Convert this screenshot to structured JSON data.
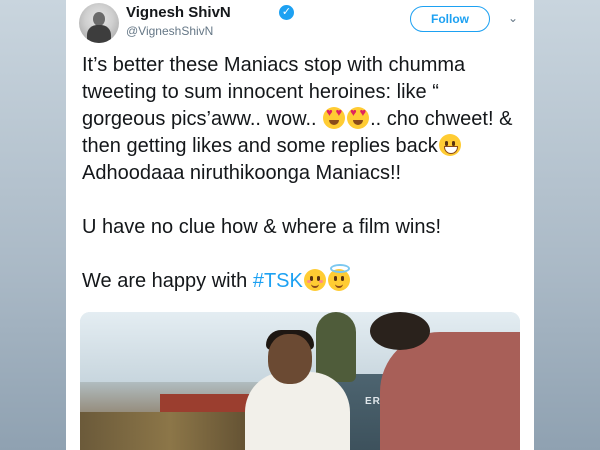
{
  "profile": {
    "name": "Vignesh ShivN",
    "handle": "@VigneshShivN",
    "verified_icon": "verified-badge-icon"
  },
  "header": {
    "follow_label": "Follow",
    "menu_icon": "chevron-down-icon"
  },
  "tweet": {
    "line1": "It’s better these Maniacs stop with chumma tweeting to sum innocent heroines: like “ gorgeous pics’aww.. wow..",
    "line1_after_emoji": ".. cho chweet! & then getting likes and some replies back",
    "line2": "Adhoodaaa niruthikoonga Maniacs!!",
    "line3": "U have no clue how & where a film wins!",
    "line4_text": "We are happy with ",
    "hashtag": "#TSK"
  },
  "media": {
    "visible_sign_text": "ERGREEN"
  },
  "colors": {
    "accent": "#1da1f2",
    "text": "#14171a",
    "secondary": "#657786"
  }
}
